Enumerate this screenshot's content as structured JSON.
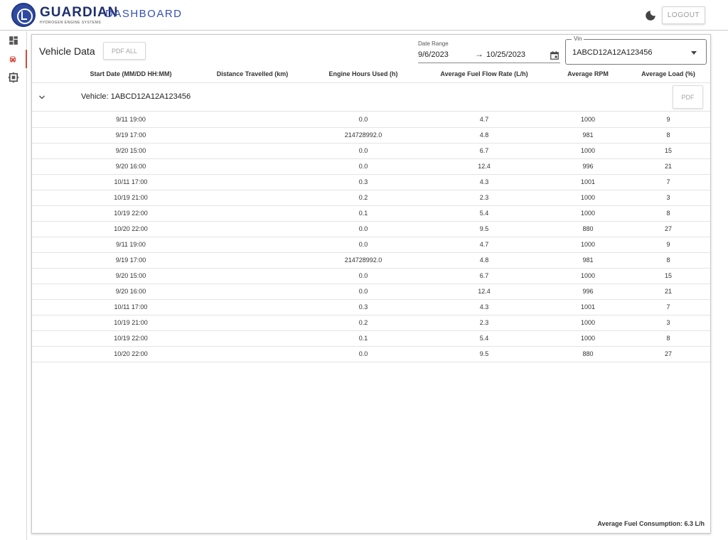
{
  "header": {
    "brand_main": "GUARDIAN",
    "brand_sub": "DASHBOARD",
    "brand_tagline": "HYDROGEN ENGINE SYSTEMS",
    "logout_label": "LOGOUT"
  },
  "sidebar": {
    "items": [
      {
        "name": "dashboard",
        "icon": "dashboard-icon",
        "active": false
      },
      {
        "name": "vehicles",
        "icon": "car-icon",
        "active": true
      },
      {
        "name": "devices",
        "icon": "device-icon",
        "active": false
      }
    ]
  },
  "panel": {
    "title": "Vehicle Data",
    "pdf_all_label": "PDF ALL",
    "date_range": {
      "label": "Date Range",
      "start": "9/6/2023",
      "arrow": "→",
      "end": "10/25/2023"
    },
    "vin": {
      "label": "Vin",
      "value": "1ABCD12A12A123456"
    },
    "columns": [
      "Start Date (MM/DD HH:MM)",
      "Distance Travelled (km)",
      "Engine Hours Used (h)",
      "Average Fuel Flow Rate (L/h)",
      "Average RPM",
      "Average Load (%)"
    ],
    "vehicle_group": {
      "label": "Vehicle:  1ABCD12A12A123456",
      "pdf_label": "PDF"
    },
    "rows": [
      [
        "9/11 19:00",
        "0.0",
        "4.7",
        "1000",
        "9"
      ],
      [
        "9/19 17:00",
        "214728992.0",
        "4.8",
        "981",
        "8"
      ],
      [
        "9/20 15:00",
        "0.0",
        "6.7",
        "1000",
        "15"
      ],
      [
        "9/20 16:00",
        "0.0",
        "12.4",
        "996",
        "21"
      ],
      [
        "10/11 17:00",
        "0.3",
        "4.3",
        "1001",
        "7"
      ],
      [
        "10/19 21:00",
        "0.2",
        "2.3",
        "1000",
        "3"
      ],
      [
        "10/19 22:00",
        "0.1",
        "5.4",
        "1000",
        "8"
      ],
      [
        "10/20 22:00",
        "0.0",
        "9.5",
        "880",
        "27"
      ],
      [
        "9/11 19:00",
        "0.0",
        "4.7",
        "1000",
        "9"
      ],
      [
        "9/19 17:00",
        "214728992.0",
        "4.8",
        "981",
        "8"
      ],
      [
        "9/20 15:00",
        "0.0",
        "6.7",
        "1000",
        "15"
      ],
      [
        "9/20 16:00",
        "0.0",
        "12.4",
        "996",
        "21"
      ],
      [
        "10/11 17:00",
        "0.3",
        "4.3",
        "1001",
        "7"
      ],
      [
        "10/19 21:00",
        "0.2",
        "2.3",
        "1000",
        "3"
      ],
      [
        "10/19 22:00",
        "0.1",
        "5.4",
        "1000",
        "8"
      ],
      [
        "10/20 22:00",
        "0.0",
        "9.5",
        "880",
        "27"
      ]
    ],
    "footer": "Average Fuel Consumption: 6.3 L/h"
  },
  "colors": {
    "brand": "#1f2f6e",
    "brand_accent": "#3550b2",
    "active_nav": "#d24a3a"
  }
}
